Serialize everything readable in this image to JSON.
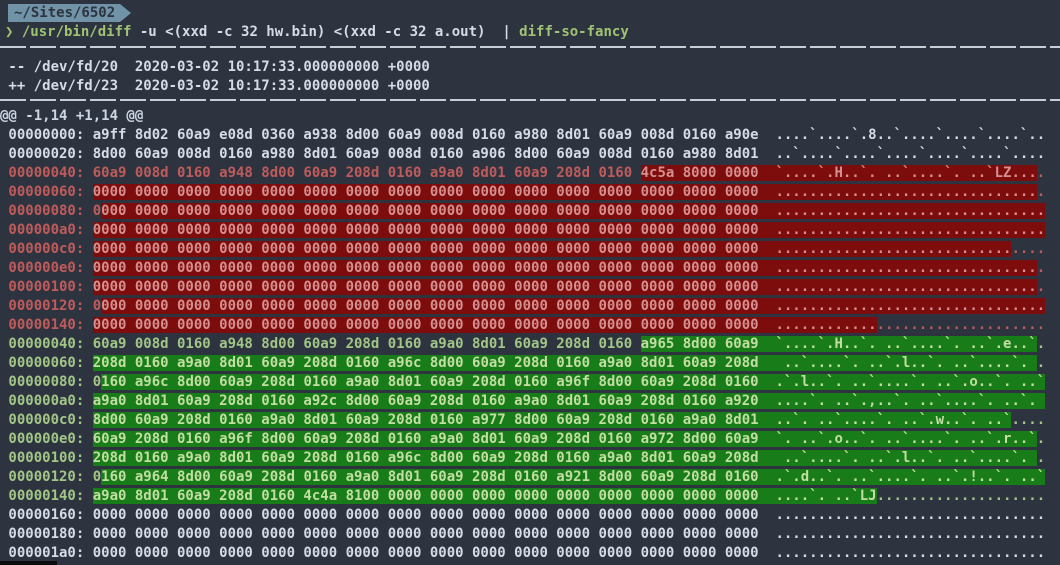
{
  "window": {
    "tab_title": "~/Sites/6502"
  },
  "prompt": {
    "symbol": "❯ ",
    "binary": "/usr/bin/diff",
    "args": " -u <(xxd -c 32 hw.bin) <(xxd -c 32 a.out)  ",
    "pipe": "| ",
    "filter": "diff-so-fancy"
  },
  "file_headers": {
    "old": " -- /dev/fd/20  2020-03-02 10:17:33.000000000 +0000",
    "new": " ++ /dev/fd/23  2020-03-02 10:17:33.000000000 +0000"
  },
  "colors": {
    "bg": "#2d3440",
    "fg": "#d6dce6",
    "hunk-fg": "#ccd6e4",
    "sep": "#c9ced6",
    "tab-bg": "#7193a8",
    "tab-fg": "#2d3440",
    "cmd-green": "#a0c373",
    "red-fg": "#c05b5b",
    "red-bg": "#7d0c0c",
    "red-hl-fg": "#d68f8f",
    "green-fg": "#a3c687",
    "green-bg": "#187c18",
    "green-hl-fg": "#c2dea2"
  },
  "diff_lines": [
    {
      "type": "hunk",
      "segments": [
        {
          "t": "@@ -1,14 +1,14 @@",
          "h": false
        }
      ]
    },
    {
      "type": "ctx",
      "segments": [
        {
          "t": " 00000000: a9ff 8d02 60a9 e08d 0360 a938 8d00 60a9 008d 0160 a980 8d01 60a9 008d 0160 a90e  ....`....`.8..`....`....`....`..",
          "h": false
        }
      ]
    },
    {
      "type": "ctx",
      "segments": [
        {
          "t": " 00000020: 8d00 60a9 008d 0160 a980 8d01 60a9 008d 0160 a906 8d00 60a9 008d 0160 a980 8d01  ..`....`....`....`....`....`....",
          "h": false
        }
      ]
    },
    {
      "type": "del",
      "segments": [
        {
          "t": " 00000040: 60a9 008d 0160 a948 8d00 60a9 208d 0160 a9a0 8d01 60a9 208d 0160 ",
          "h": false
        },
        {
          "t": "4c5a 8000 0000  `....`.H..`. ..`....`. ..`LZ...",
          "h": true
        },
        {
          "t": ".",
          "h": false
        }
      ]
    },
    {
      "type": "del",
      "segments": [
        {
          "t": " 00000060: ",
          "h": false
        },
        {
          "t": "0000 0000 0000 0000 0000 0000 0000 0000 0000 0000 0000 0000 0000 0000 0000 0000  ...............................",
          "h": true
        },
        {
          "t": ".",
          "h": false
        }
      ]
    },
    {
      "type": "del",
      "segments": [
        {
          "t": " 00000080: 0",
          "h": false
        },
        {
          "t": "000 0000 0000 0000 0000 0000 0000 0000 0000 0000 0000 0000 0000 0000 0000 0000  ................................",
          "h": true
        }
      ]
    },
    {
      "type": "del",
      "segments": [
        {
          "t": " 000000a0: ",
          "h": false
        },
        {
          "t": "0000 0000 0000 0000 0000 0000 0000 0000 0000 0000 0000 0000 0000 0000 0000 0000  ................................",
          "h": true
        }
      ]
    },
    {
      "type": "del",
      "segments": [
        {
          "t": " 000000c0: ",
          "h": false
        },
        {
          "t": "0000 0000 0000 0000 0000 0000 0000 0000 0000 0000 0000 0000 0000 0000 0000 0000  ............................",
          "h": true
        },
        {
          "t": "....",
          "h": false
        }
      ]
    },
    {
      "type": "del",
      "segments": [
        {
          "t": " 000000e0: ",
          "h": false
        },
        {
          "t": "0000 0000 0000 0000 0000 0000 0000 0000 0000 0000 0000 0000 0000 0000 0000 0000  ...............................",
          "h": true
        },
        {
          "t": ".",
          "h": false
        }
      ]
    },
    {
      "type": "del",
      "segments": [
        {
          "t": " 00000100: ",
          "h": false
        },
        {
          "t": "0000 0000 0000 0000 0000 0000 0000 0000 0000 0000 0000 0000 0000 0000 0000 0000  ...............................",
          "h": true
        },
        {
          "t": ".",
          "h": false
        }
      ]
    },
    {
      "type": "del",
      "segments": [
        {
          "t": " 00000120: 0",
          "h": false
        },
        {
          "t": "000 0000 0000 0000 0000 0000 0000 0000 0000 0000 0000 0000 0000 0000 0000 0000  ................................",
          "h": true
        }
      ]
    },
    {
      "type": "del",
      "segments": [
        {
          "t": " 00000140: ",
          "h": false
        },
        {
          "t": "0000 0000 0000 0000 0000 0000 0000 0000 0000 0000 0000 0000 0000 0000 0000 0000  ............",
          "h": true
        },
        {
          "t": "....................",
          "h": false
        }
      ]
    },
    {
      "type": "add",
      "segments": [
        {
          "t": " 00000040: 60a9 008d 0160 a948 8d00 60a9 208d 0160 a9a0 8d01 60a9 208d 0160 ",
          "h": false
        },
        {
          "t": "a965 8d00 60a9  `....`.H..`. ..`....`. ..`.e..`",
          "h": true
        },
        {
          "t": ".",
          "h": false
        }
      ]
    },
    {
      "type": "add",
      "segments": [
        {
          "t": " 00000060: ",
          "h": false
        },
        {
          "t": "208d 0160 a9a0 8d01 60a9 208d 0160 a96c 8d00 60a9 208d 0160 a9a0 8d01 60a9 208d   ..`....`. ..`.l..`. ..`....`. ",
          "h": true
        },
        {
          "t": ".",
          "h": false
        }
      ]
    },
    {
      "type": "add",
      "segments": [
        {
          "t": " 00000080: 0",
          "h": false
        },
        {
          "t": "160 a96c 8d00 60a9 208d 0160 a9a0 8d01 60a9 208d 0160 a96f 8d00 60a9 208d 0160  .`.l..`. ..`....`. ..`.o..`. ..`",
          "h": true
        }
      ]
    },
    {
      "type": "add",
      "segments": [
        {
          "t": " 000000a0: ",
          "h": false
        },
        {
          "t": "a9a0 8d01 60a9 208d 0160 a92c 8d00 60a9 208d 0160 a9a0 8d01 60a9 208d 0160 a920  ....`. ..`.,..`. ..`....`. ..`. ",
          "h": true
        }
      ]
    },
    {
      "type": "add",
      "segments": [
        {
          "t": " 000000c0: ",
          "h": false
        },
        {
          "t": "8d00 60a9 208d 0160 a9a0 8d01 60a9 208d 0160 a977 8d00 60a9 208d 0160 a9a0 8d01  ..`. ..`....`. ..`.w..`. ..`",
          "h": true
        },
        {
          "t": "....",
          "h": false
        }
      ]
    },
    {
      "type": "add",
      "segments": [
        {
          "t": " 000000e0: ",
          "h": false
        },
        {
          "t": "60a9 208d 0160 a96f 8d00 60a9 208d 0160 a9a0 8d01 60a9 208d 0160 a972 8d00 60a9  `. ..`.o..`. ..`....`. ..`.r..`",
          "h": true
        },
        {
          "t": ".",
          "h": false
        }
      ]
    },
    {
      "type": "add",
      "segments": [
        {
          "t": " 00000100: ",
          "h": false
        },
        {
          "t": "208d 0160 a9a0 8d01 60a9 208d 0160 a96c 8d00 60a9 208d 0160 a9a0 8d01 60a9 208d   ..`....`. ..`.l..`. ..`....`. ",
          "h": true
        },
        {
          "t": ".",
          "h": false
        }
      ]
    },
    {
      "type": "add",
      "segments": [
        {
          "t": " 00000120: 0",
          "h": false
        },
        {
          "t": "160 a964 8d00 60a9 208d 0160 a9a0 8d01 60a9 208d 0160 a921 8d00 60a9 208d 0160  .`.d..`. ..`....`. ..`.!..`. ..`",
          "h": true
        }
      ]
    },
    {
      "type": "add",
      "segments": [
        {
          "t": " 00000140: ",
          "h": false
        },
        {
          "t": "a9a0 8d01 60a9 208d 0160 4c4a 8100 0000 0000 0000 0000 0000 0000 0000 0000 0000  ....`. ..`LJ",
          "h": true
        },
        {
          "t": "....................",
          "h": false
        }
      ]
    },
    {
      "type": "ctx",
      "segments": [
        {
          "t": " 00000160: 0000 0000 0000 0000 0000 0000 0000 0000 0000 0000 0000 0000 0000 0000 0000 0000  ................................",
          "h": false
        }
      ]
    },
    {
      "type": "ctx",
      "segments": [
        {
          "t": " 00000180: 0000 0000 0000 0000 0000 0000 0000 0000 0000 0000 0000 0000 0000 0000 0000 0000  ................................",
          "h": false
        }
      ]
    },
    {
      "type": "ctx",
      "segments": [
        {
          "t": " 000001a0: 0000 0000 0000 0000 0000 0000 0000 0000 0000 0000 0000 0000 0000 0000 0000 0000  ................................",
          "h": false
        }
      ]
    }
  ]
}
